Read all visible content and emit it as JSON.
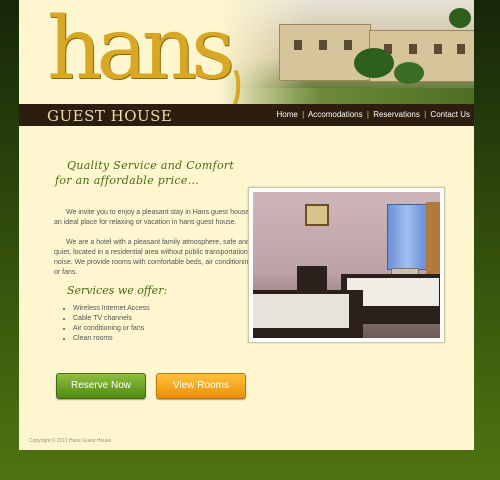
{
  "brand": {
    "logo_word": "hans",
    "sub_title": "GUEST HOUSE"
  },
  "nav": {
    "items": [
      "Home",
      "Accomodations",
      "Reservations",
      "Contact Us"
    ]
  },
  "tagline": {
    "line1": "Quality Service and Comfort",
    "line2": "for an affordable price..."
  },
  "intro": {
    "p1": "We invite you to enjoy a pleasant stay in Hans guest house, an ideal place for relaxing or vacation in hans guest house.",
    "p2": "We are a hotel with a pleasant family atmosphere, safe and quiet, located in a residential area without public transportation noise. We provide rooms with comfortable beds, air conditioning or fans."
  },
  "services": {
    "title": "Services we offer:",
    "items": [
      "Wireless Internet Access",
      "Cable TV channels",
      "Air conditioning or fans",
      "Clean rooms"
    ]
  },
  "buttons": {
    "reserve": "Reserve Now",
    "view": "View Rooms"
  },
  "footer": {
    "copyright": "Copyright © 2011 Hans Guest House"
  },
  "colors": {
    "accent_gold": "#d7a725",
    "heading_green": "#4a6a12",
    "reserve_green": "#4f8a14",
    "view_orange": "#e98f0a"
  }
}
